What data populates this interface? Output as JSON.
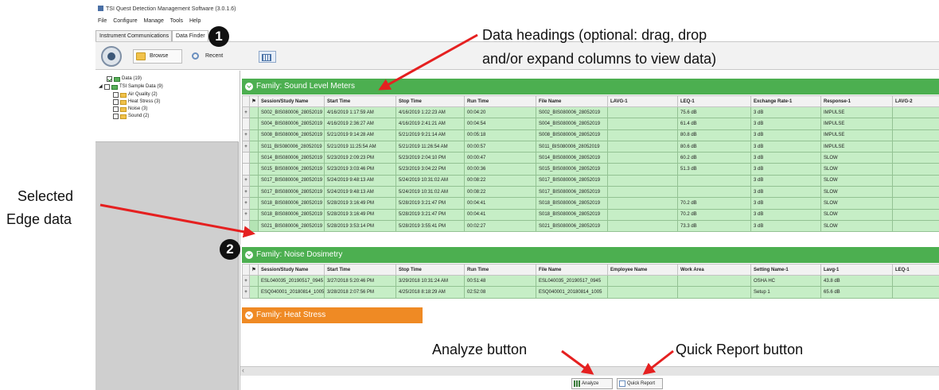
{
  "window": {
    "title": "TSI Quest Detection Management Software (3.0.1.6)"
  },
  "menu": [
    "File",
    "Configure",
    "Manage",
    "Tools",
    "Help"
  ],
  "tabs": [
    "Instrument Communications",
    "Data Finder"
  ],
  "toolbar": {
    "browse_label": "Browse",
    "recent_label": "Recent"
  },
  "tree": {
    "data": "Data (19)",
    "sample": "TSI Sample Data (9)",
    "air_quality": "Air Quality (2)",
    "heat_stress": "Heat Stress (3)",
    "noise": "Noise (3)",
    "sound": "Sound (2)"
  },
  "families": {
    "sound": {
      "title": "Family: Sound Level Meters",
      "columns": [
        "Session/Study Name",
        "Start Time",
        "Stop Time",
        "Run Time",
        "File Name",
        "LAVG-1",
        "LEQ-1",
        "Exchange Rate-1",
        "Response-1",
        "LAVG-2"
      ],
      "rows": [
        {
          "pm": "+",
          "cells": [
            "S002_BIS080006_28052019",
            "4/16/2019 1:17:59 AM",
            "4/16/2019 1:22:23 AM",
            "00:04:20",
            "S002_BIS080006_28052019",
            "",
            "75.6 dB",
            "3 dB",
            "IMPULSE",
            ""
          ]
        },
        {
          "pm": "",
          "cells": [
            "S004_BIS080006_28052019",
            "4/16/2019 2:36:27 AM",
            "4/16/2019 2:41:21 AM",
            "00:04:54",
            "S004_BIS080006_28052019",
            "",
            "61.4 dB",
            "3 dB",
            "IMPULSE",
            ""
          ]
        },
        {
          "pm": "+",
          "cells": [
            "S008_BIS080006_28052019",
            "5/21/2019 9:14:28 AM",
            "5/21/2019 9:21:14 AM",
            "00:05:18",
            "S008_BIS080006_28052019",
            "",
            "80.8 dB",
            "3 dB",
            "IMPULSE",
            ""
          ]
        },
        {
          "pm": "+",
          "cells": [
            "S011_BIS080006_28052019",
            "5/21/2019 11:25:54 AM",
            "5/21/2019 11:26:54 AM",
            "00:00:57",
            "S011_BIS080006_28052019",
            "",
            "80.6 dB",
            "3 dB",
            "IMPULSE",
            ""
          ]
        },
        {
          "pm": "",
          "cells": [
            "S014_BIS080006_28052019",
            "5/23/2019 2:09:23 PM",
            "5/23/2019 2:04:10 PM",
            "00:00:47",
            "S014_BIS080006_28052019",
            "",
            "60.2 dB",
            "3 dB",
            "SLOW",
            ""
          ]
        },
        {
          "pm": "",
          "cells": [
            "S015_BIS080006_28052019",
            "5/23/2019 3:03:46 PM",
            "5/23/2019 3:04:22 PM",
            "00:00:36",
            "S015_BIS080006_28052019",
            "",
            "51.3 dB",
            "3 dB",
            "SLOW",
            ""
          ]
        },
        {
          "pm": "+",
          "cells": [
            "S017_BIS080006_28052019",
            "5/24/2019 9:48:13 AM",
            "5/24/2019 10:31:02 AM",
            "00:08:22",
            "S017_BIS080006_28052019",
            "",
            "",
            "3 dB",
            "SLOW",
            ""
          ]
        },
        {
          "pm": "+",
          "cells": [
            "S017_BIS080006_28052019",
            "5/24/2019 9:48:13 AM",
            "5/24/2019 10:31:02 AM",
            "00:08:22",
            "S017_BIS080006_28052019",
            "",
            "",
            "3 dB",
            "SLOW",
            ""
          ]
        },
        {
          "pm": "+",
          "cells": [
            "S018_BIS080006_28052019",
            "5/28/2019 3:16:49 PM",
            "5/28/2019 3:21:47 PM",
            "00:04:41",
            "S018_BIS080006_28052019",
            "",
            "70.2 dB",
            "3 dB",
            "SLOW",
            ""
          ]
        },
        {
          "pm": "+",
          "cells": [
            "S018_BIS080006_28052019",
            "5/28/2019 3:16:49 PM",
            "5/28/2019 3:21:47 PM",
            "00:04:41",
            "S018_BIS080006_28052019",
            "",
            "70.2 dB",
            "3 dB",
            "SLOW",
            ""
          ]
        },
        {
          "pm": "",
          "cells": [
            "S021_BIS080006_28052019",
            "5/28/2019 3:53:14 PM",
            "5/28/2019 3:55:41 PM",
            "00:02:27",
            "S021_BIS080006_28052019",
            "",
            "73.3 dB",
            "3 dB",
            "SLOW",
            ""
          ]
        }
      ]
    },
    "noise": {
      "title": "Family: Noise Dosimetry",
      "columns": [
        "Session/Study Name",
        "Start Time",
        "Stop Time",
        "Run Time",
        "File Name",
        "Employee Name",
        "Work Area",
        "Setting Name-1",
        "Lavg-1",
        "LEQ-1"
      ],
      "rows": [
        {
          "pm": "+",
          "cells": [
            "ESL040035_20190517_0945",
            "3/27/2018 5:20:46 PM",
            "3/29/2018 10:31:24 AM",
            "00:51:48",
            "ESL040035_20190517_0945",
            "",
            "",
            "OSHA HC",
            "43.8 dB",
            ""
          ]
        },
        {
          "pm": "+",
          "cells": [
            "ESQ040001_20180814_1005",
            "3/28/2018 2:07:56 PM",
            "4/25/2018 8:18:29 AM",
            "02:52:08",
            "ESQ040001_20180814_1005",
            "",
            "",
            "Setup 1",
            "65.6 dB",
            ""
          ]
        }
      ]
    },
    "heat": {
      "title": "Family: Heat Stress"
    }
  },
  "bottom": {
    "analyze_label": "Analyze",
    "quick_report_label": "Quick Report"
  },
  "annotations": {
    "badge1": "1",
    "badge2": "2",
    "headings_line1": "Data headings (optional: drag, drop",
    "headings_line2": "and/or expand columns to view data)",
    "selected_line1": "Selected",
    "selected_line2": "Edge data",
    "analyze": "Analyze button",
    "quick_report": "Quick Report button"
  },
  "colors": {
    "family_green": "#4caf50",
    "family_orange": "#ef8a24",
    "row_green": "#c6eec6",
    "arrow_red": "#e52020"
  }
}
